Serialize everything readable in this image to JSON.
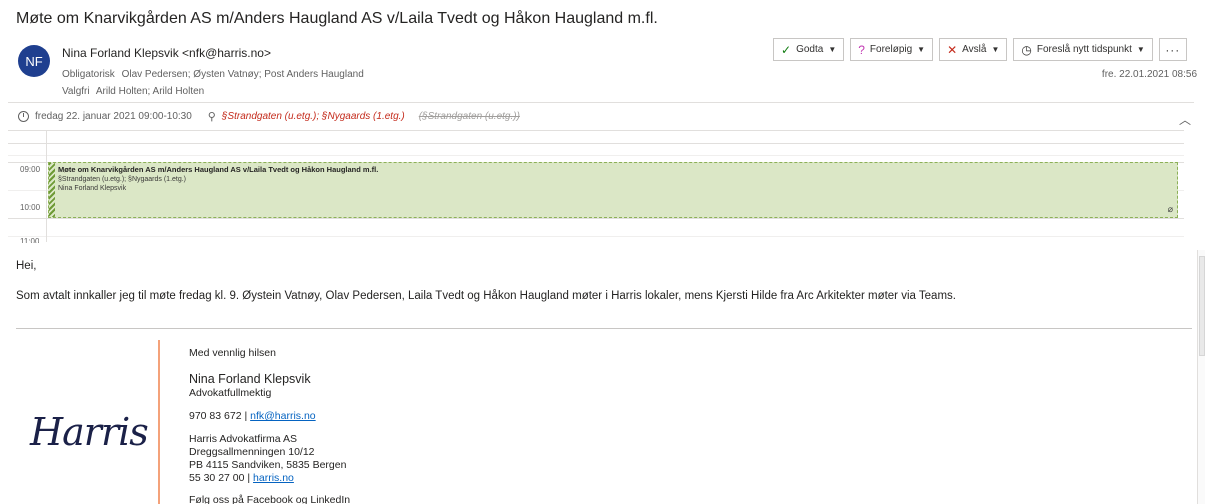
{
  "subject": "Møte om Knarvikgården AS m/Anders Haugland AS v/Laila Tvedt og Håkon Haugland m.fl.",
  "sender": {
    "initials": "NF",
    "display": "Nina Forland Klepsvik <nfk@harris.no>",
    "avatar_color": "#1f3f8f"
  },
  "recipients": {
    "required_label": "Obligatorisk",
    "required": "Olav Pedersen; Øysten Vatnøy; Post Anders  Haugland",
    "optional_label": "Valgfri",
    "optional": "Arild Holten; Arild Holten"
  },
  "actions": {
    "accept": "Godta",
    "tentative": "Foreløpig",
    "decline": "Avslå",
    "propose": "Foreslå nytt tidspunkt",
    "more": "···"
  },
  "sent_date": "fre. 22.01.2021 08:56",
  "meeting": {
    "when": "fredag 22. januar 2021 09:00-10:30",
    "location": "§Strandgaten (u.etg.); §Nygaards (1.etg.)",
    "old_location": "(§Strandgaten (u.etg.))"
  },
  "calendar": {
    "times": [
      "09:00",
      "10:00",
      "11:00"
    ],
    "event_title": "Møte om Knarvikgården AS m/Anders Haugland AS v/Laila Tvedt og Håkon Haugland m.fl.",
    "event_location": "§Strandgaten (u.etg.); §Nygaards (1.etg.)",
    "event_organizer": "Nina Forland Klepsvik"
  },
  "body": {
    "greeting": "Hei,",
    "paragraph": "Som avtalt innkaller jeg til møte fredag kl. 9. Øystein Vatnøy, Olav Pedersen, Laila Tvedt og Håkon Haugland møter i Harris lokaler, mens Kjersti Hilde fra Arc Arkitekter møter via Teams."
  },
  "signature": {
    "closing": "Med vennlig hilsen",
    "name": "Nina Forland Klepsvik",
    "title": "Advokatfullmektig",
    "phone": "970 83 672 | ",
    "email": "nfk@harris.no",
    "company": "Harris Advokatfirma AS",
    "street": "Dreggsallmenningen 10/12",
    "po": "PB  4115 Sandviken, 5835 Bergen",
    "switchboard": "55 30 27 00 | ",
    "web": "harris.no",
    "social": "Følg oss på Facebook og LinkedIn",
    "logo_text": "Harris"
  }
}
